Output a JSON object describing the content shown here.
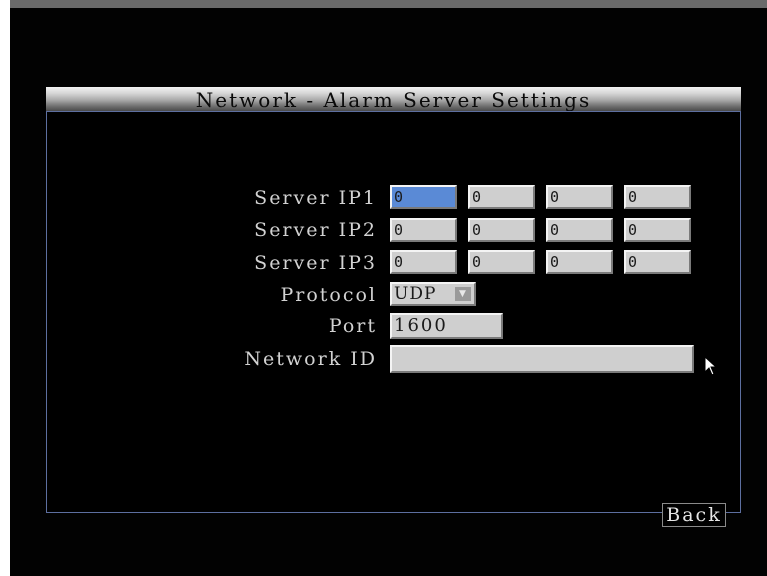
{
  "window": {
    "title": "Network - Alarm Server Settings"
  },
  "form": {
    "server_ip1": {
      "label": "Server IP1",
      "octets": [
        "0",
        "0",
        "0",
        "0"
      ]
    },
    "server_ip2": {
      "label": "Server IP2",
      "octets": [
        "0",
        "0",
        "0",
        "0"
      ]
    },
    "server_ip3": {
      "label": "Server IP3",
      "octets": [
        "0",
        "0",
        "0",
        "0"
      ]
    },
    "protocol": {
      "label": "Protocol",
      "value": "UDP"
    },
    "port": {
      "label": "Port",
      "value": "1600"
    },
    "network_id": {
      "label": "Network ID",
      "value": ""
    }
  },
  "buttons": {
    "back_label": "Back"
  },
  "icons": {
    "dropdown": "chevron-down-icon",
    "cursor": "mouse-pointer-icon"
  },
  "colors": {
    "focused_field": "#5a8ad6",
    "field_background": "#cfcfcf",
    "frame_border": "#5d6fa0"
  }
}
